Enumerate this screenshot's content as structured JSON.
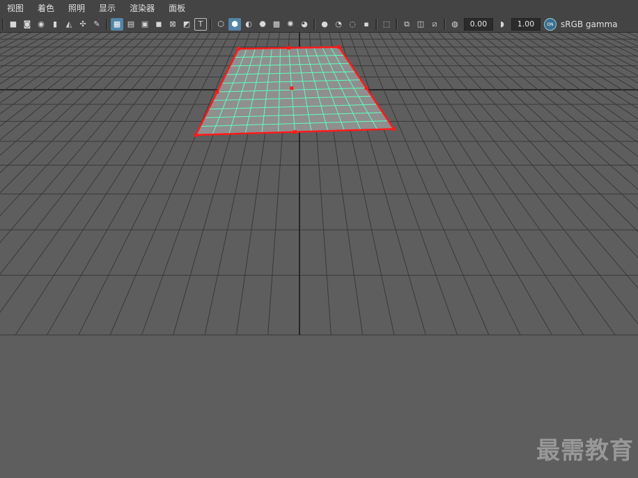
{
  "menu": {
    "items": [
      "视图",
      "着色",
      "照明",
      "显示",
      "渲染器",
      "面板"
    ]
  },
  "toolbar": {
    "exposure_value": "0.00",
    "gamma_value": "1.00",
    "color_space_label": "sRGB gamma",
    "icons": [
      "camera-icon",
      "camera-lock-icon",
      "camera-attributes-icon",
      "bookmark-icon",
      "image-plane-icon",
      "grid-snap-icon",
      "paint-brush-icon",
      "grid-toggle-icon",
      "film-gate-icon",
      "resolution-gate-icon",
      "gate-mask-icon",
      "field-chart-icon",
      "safe-action-icon",
      "safe-title-icon",
      "wireframe-icon",
      "smooth-shade-icon",
      "default-material-icon",
      "wireframe-on-shaded-icon",
      "x-ray-icon",
      "use-default-lights-icon",
      "shadows-icon",
      "ambient-occlusion-icon",
      "motion-blur-icon",
      "anti-aliasing-icon",
      "depth-of-field-icon",
      "isolate-select-icon",
      "xray-joints-icon",
      "xray-active-icon",
      "backface-culling-icon",
      "exposure-icon",
      "gamma-icon",
      "color-management-icon"
    ]
  },
  "viewport": {
    "background_color": "#5e5e5e",
    "grid_color": "#393939",
    "axis_color": "#262626",
    "plane_color": "#8f8f8f",
    "plane_wire_color": "#5effbf",
    "selection_color": "#ff1a1a",
    "plane": {
      "subdivisions_width": 12,
      "subdivisions_height": 10
    }
  },
  "watermark": "最需教育"
}
